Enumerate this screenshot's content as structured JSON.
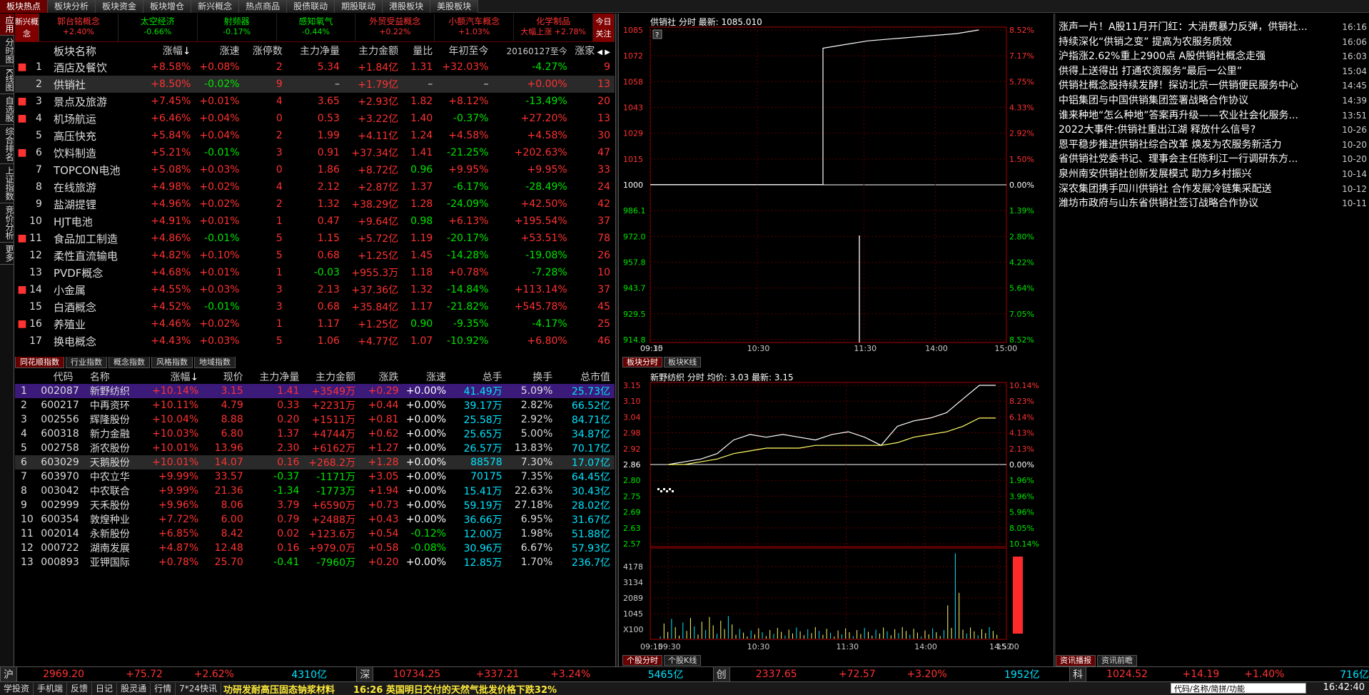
{
  "top_tabs": [
    "板块热点",
    "板块分析",
    "板块资金",
    "板块增仓",
    "新兴概念",
    "热点商品",
    "股债联动",
    "期股联动",
    "港股板块",
    "美股板块"
  ],
  "left_nav": [
    "应用",
    "分时图",
    "K线图",
    "自选股",
    "综合排名",
    "上证指数",
    "竞价分析",
    "更多"
  ],
  "concept_bar": {
    "left_label": "新兴概念",
    "right_label": "今日关注",
    "items": [
      {
        "name": "郭台铭概念",
        "pct": "+2.40%",
        "color": "#ff3232"
      },
      {
        "name": "太空经济",
        "pct": "-0.66%",
        "color": "#00e600"
      },
      {
        "name": "射频器",
        "pct": "-0.17%",
        "color": "#00e600"
      },
      {
        "name": "感知氧气",
        "pct": "-0.44%",
        "color": "#00e600"
      },
      {
        "name": "外贸受益概念",
        "pct": "+0.22%",
        "color": "#ff3232"
      },
      {
        "name": "小额汽车概念",
        "pct": "+1.03%",
        "color": "#ff3232"
      },
      {
        "name": "化学制品",
        "pct": "大幅上涨 +2.78%",
        "color": "#ff3232"
      }
    ]
  },
  "sector_table": {
    "headers": [
      "板块名称",
      "涨幅",
      "涨速",
      "涨停数",
      "主力净量",
      "主力金额",
      "量比",
      "年初至今",
      "20160127至今",
      "涨家"
    ],
    "rows": [
      {
        "idx": "1",
        "mark": "■",
        "name": "酒店及餐饮",
        "chg": "+8.58%",
        "spd": "+0.08%",
        "lim": "2",
        "net": "5.34",
        "amt": "+1.84亿",
        "vr": "1.31",
        "ytd": "+32.03%",
        "since": "-4.27%",
        "up": "9"
      },
      {
        "idx": "2",
        "mark": "",
        "name": "供销社",
        "chg": "+8.50%",
        "spd": "-0.02%",
        "lim": "9",
        "net": "–",
        "amt": "+1.79亿",
        "vr": "–",
        "ytd": "–",
        "since": "+0.00%",
        "up": "13"
      },
      {
        "idx": "3",
        "mark": "■",
        "name": "景点及旅游",
        "chg": "+7.45%",
        "spd": "+0.01%",
        "lim": "4",
        "net": "3.65",
        "amt": "+2.93亿",
        "vr": "1.82",
        "ytd": "+8.12%",
        "since": "-13.49%",
        "up": "20"
      },
      {
        "idx": "4",
        "mark": "■",
        "name": "机场航运",
        "chg": "+6.46%",
        "spd": "+0.04%",
        "lim": "0",
        "net": "0.53",
        "amt": "+3.22亿",
        "vr": "1.40",
        "ytd": "-0.37%",
        "since": "+27.20%",
        "up": "13"
      },
      {
        "idx": "5",
        "mark": "",
        "name": "高压快充",
        "chg": "+5.84%",
        "spd": "+0.04%",
        "lim": "2",
        "net": "1.99",
        "amt": "+4.11亿",
        "vr": "1.24",
        "ytd": "+4.58%",
        "since": "+4.58%",
        "up": "30"
      },
      {
        "idx": "6",
        "mark": "■",
        "name": "饮料制造",
        "chg": "+5.21%",
        "spd": "-0.01%",
        "lim": "3",
        "net": "0.91",
        "amt": "+37.34亿",
        "vr": "1.41",
        "ytd": "-21.25%",
        "since": "+202.63%",
        "up": "47"
      },
      {
        "idx": "7",
        "mark": "",
        "name": "TOPCON电池",
        "chg": "+5.08%",
        "spd": "+0.03%",
        "lim": "0",
        "net": "1.86",
        "amt": "+8.72亿",
        "vr": "0.96",
        "ytd": "+9.95%",
        "since": "+9.95%",
        "up": "33"
      },
      {
        "idx": "8",
        "mark": "",
        "name": "在线旅游",
        "chg": "+4.98%",
        "spd": "+0.02%",
        "lim": "4",
        "net": "2.12",
        "amt": "+2.87亿",
        "vr": "1.37",
        "ytd": "-6.17%",
        "since": "-28.49%",
        "up": "24"
      },
      {
        "idx": "9",
        "mark": "",
        "name": "盐湖提锂",
        "chg": "+4.96%",
        "spd": "+0.02%",
        "lim": "2",
        "net": "1.32",
        "amt": "+38.29亿",
        "vr": "1.28",
        "ytd": "-24.09%",
        "since": "+42.50%",
        "up": "42"
      },
      {
        "idx": "10",
        "mark": "",
        "name": "HJT电池",
        "chg": "+4.91%",
        "spd": "+0.01%",
        "lim": "1",
        "net": "0.47",
        "amt": "+9.64亿",
        "vr": "0.98",
        "ytd": "+6.13%",
        "since": "+195.54%",
        "up": "37"
      },
      {
        "idx": "11",
        "mark": "■",
        "name": "食品加工制造",
        "chg": "+4.86%",
        "spd": "-0.01%",
        "lim": "5",
        "net": "1.15",
        "amt": "+5.72亿",
        "vr": "1.19",
        "ytd": "-20.17%",
        "since": "+53.51%",
        "up": "78"
      },
      {
        "idx": "12",
        "mark": "",
        "name": "柔性直流输电",
        "chg": "+4.82%",
        "spd": "+0.10%",
        "lim": "5",
        "net": "0.68",
        "amt": "+1.25亿",
        "vr": "1.45",
        "ytd": "-14.28%",
        "since": "-19.08%",
        "up": "26"
      },
      {
        "idx": "13",
        "mark": "",
        "name": "PVDF概念",
        "chg": "+4.68%",
        "spd": "+0.01%",
        "lim": "1",
        "net": "-0.03",
        "amt": "+955.3万",
        "vr": "1.18",
        "ytd": "+0.78%",
        "since": "-7.28%",
        "up": "10"
      },
      {
        "idx": "14",
        "mark": "■",
        "name": "小金属",
        "chg": "+4.55%",
        "spd": "+0.03%",
        "lim": "3",
        "net": "2.13",
        "amt": "+37.36亿",
        "vr": "1.32",
        "ytd": "-14.84%",
        "since": "+113.14%",
        "up": "37"
      },
      {
        "idx": "15",
        "mark": "",
        "name": "白酒概念",
        "chg": "+4.52%",
        "spd": "-0.01%",
        "lim": "3",
        "net": "0.68",
        "amt": "+35.84亿",
        "vr": "1.17",
        "ytd": "-21.82%",
        "since": "+545.78%",
        "up": "45"
      },
      {
        "idx": "16",
        "mark": "■",
        "name": "养殖业",
        "chg": "+4.46%",
        "spd": "+0.02%",
        "lim": "1",
        "net": "1.17",
        "amt": "+1.25亿",
        "vr": "0.90",
        "ytd": "-9.35%",
        "since": "-4.17%",
        "up": "25"
      },
      {
        "idx": "17",
        "mark": "",
        "name": "换电概念",
        "chg": "+4.43%",
        "spd": "+0.03%",
        "lim": "5",
        "net": "1.06",
        "amt": "+4.77亿",
        "vr": "1.07",
        "ytd": "-10.92%",
        "since": "+6.80%",
        "up": "46"
      }
    ]
  },
  "index_tabs": [
    "同花顺指数",
    "行业指数",
    "概念指数",
    "风格指数",
    "地域指数"
  ],
  "stock_table": {
    "headers": [
      "代码",
      "名称",
      "涨幅",
      "现价",
      "主力净量",
      "主力金额",
      "涨跌",
      "涨速",
      "总手",
      "换手",
      "总市值"
    ],
    "rows": [
      {
        "idx": "1",
        "code": "002087",
        "name": "新野纺织",
        "chg": "+10.14%",
        "price": "3.15",
        "net": "1.41",
        "amt": "+3549万",
        "diff": "+0.29",
        "spd": "+0.00%",
        "vol": "41.49万",
        "turn": "5.09%",
        "cap": "25.73亿"
      },
      {
        "idx": "2",
        "code": "600217",
        "name": "中再资环",
        "chg": "+10.11%",
        "price": "4.79",
        "net": "0.33",
        "amt": "+2231万",
        "diff": "+0.44",
        "spd": "+0.00%",
        "vol": "39.17万",
        "turn": "2.82%",
        "cap": "66.52亿"
      },
      {
        "idx": "3",
        "code": "002556",
        "name": "辉隆股份",
        "chg": "+10.04%",
        "price": "8.88",
        "net": "0.20",
        "amt": "+1511万",
        "diff": "+0.81",
        "spd": "+0.00%",
        "vol": "25.58万",
        "turn": "2.92%",
        "cap": "84.71亿"
      },
      {
        "idx": "4",
        "code": "600318",
        "name": "新力金融",
        "chg": "+10.03%",
        "price": "6.80",
        "net": "1.37",
        "amt": "+4744万",
        "diff": "+0.62",
        "spd": "+0.00%",
        "vol": "25.65万",
        "turn": "5.00%",
        "cap": "34.87亿"
      },
      {
        "idx": "5",
        "code": "002758",
        "name": "浙农股份",
        "chg": "+10.01%",
        "price": "13.96",
        "net": "2.30",
        "amt": "+6162万",
        "diff": "+1.27",
        "spd": "+0.00%",
        "vol": "26.57万",
        "turn": "13.83%",
        "cap": "70.17亿"
      },
      {
        "idx": "6",
        "code": "603029",
        "name": "天鹅股份",
        "chg": "+10.01%",
        "price": "14.07",
        "net": "0.16",
        "amt": "+268.2万",
        "diff": "+1.28",
        "spd": "+0.00%",
        "vol": "88578",
        "turn": "7.30%",
        "cap": "17.07亿"
      },
      {
        "idx": "7",
        "code": "603970",
        "name": "中农立华",
        "chg": "+9.99%",
        "price": "33.57",
        "net": "-0.37",
        "amt": "-1171万",
        "diff": "+3.05",
        "spd": "+0.00%",
        "vol": "70175",
        "turn": "7.35%",
        "cap": "64.45亿"
      },
      {
        "idx": "8",
        "code": "003042",
        "name": "中农联合",
        "chg": "+9.99%",
        "price": "21.36",
        "net": "-1.34",
        "amt": "-1773万",
        "diff": "+1.94",
        "spd": "+0.00%",
        "vol": "15.41万",
        "turn": "22.63%",
        "cap": "30.43亿"
      },
      {
        "idx": "9",
        "code": "002999",
        "name": "天禾股份",
        "chg": "+9.96%",
        "price": "8.06",
        "net": "3.79",
        "amt": "+6590万",
        "diff": "+0.73",
        "spd": "+0.00%",
        "vol": "59.19万",
        "turn": "27.18%",
        "cap": "28.02亿"
      },
      {
        "idx": "10",
        "code": "600354",
        "name": "敦煌种业",
        "chg": "+7.72%",
        "price": "6.00",
        "net": "0.79",
        "amt": "+2488万",
        "diff": "+0.43",
        "spd": "+0.00%",
        "vol": "36.66万",
        "turn": "6.95%",
        "cap": "31.67亿"
      },
      {
        "idx": "11",
        "code": "002014",
        "name": "永新股份",
        "chg": "+6.85%",
        "price": "8.42",
        "net": "0.02",
        "amt": "+123.6万",
        "diff": "+0.54",
        "spd": "-0.12%",
        "vol": "12.00万",
        "turn": "1.98%",
        "cap": "51.88亿"
      },
      {
        "idx": "12",
        "code": "000722",
        "name": "湖南发展",
        "chg": "+4.87%",
        "price": "12.48",
        "net": "0.16",
        "amt": "+979.0万",
        "diff": "+0.58",
        "spd": "-0.08%",
        "vol": "30.96万",
        "turn": "6.67%",
        "cap": "57.93亿"
      },
      {
        "idx": "13",
        "code": "000893",
        "name": "亚钾国际",
        "chg": "+0.78%",
        "price": "25.70",
        "net": "-0.41",
        "amt": "-7960万",
        "diff": "+0.20",
        "spd": "+0.00%",
        "vol": "12.85万",
        "turn": "1.70%",
        "cap": "236.7亿"
      }
    ]
  },
  "chart_data": [
    {
      "type": "line",
      "title": "供销社 分时 最新: 1085.010",
      "x_ticks": [
        "09:15",
        "09:30",
        "10:30",
        "11:30",
        "14:00",
        "15:00"
      ],
      "y_left_ticks": [
        "1085",
        "1072",
        "1058",
        "1043",
        "1029",
        "1015",
        "1000",
        "986.1",
        "972.0",
        "957.8",
        "943.7",
        "929.5",
        "914.8"
      ],
      "y_right_ticks": [
        "8.52%",
        "7.17%",
        "5.75%",
        "4.33%",
        "2.92%",
        "1.50%",
        "0.00%",
        "1.39%",
        "2.80%",
        "4.22%",
        "5.64%",
        "7.05%",
        "8.52%"
      ],
      "base": 1000,
      "ylim": [
        914.8,
        1085
      ],
      "series": [
        {
          "values": [
            1000,
            1000,
            1000,
            1000,
            1075,
            1077,
            1079,
            1080,
            1081,
            1082,
            1083,
            1085
          ]
        }
      ],
      "tabs": [
        "板块分时",
        "板块K线"
      ]
    },
    {
      "type": "line",
      "title": "新野纺织 分时 均价: 3.03 最新: 3.15",
      "x_ticks": [
        "09:15",
        "09:30",
        "10:30",
        "11:30",
        "14:00",
        "14:57",
        "15:00"
      ],
      "y_left_ticks": [
        "3.15",
        "3.10",
        "3.04",
        "2.98",
        "2.92",
        "2.86",
        "2.80",
        "2.75",
        "2.69",
        "2.63",
        "2.57"
      ],
      "y_right_ticks": [
        "10.14%",
        "8.23%",
        "6.14%",
        "4.13%",
        "2.13%",
        "0.00%",
        "1.96%",
        "3.96%",
        "5.96%",
        "8.05%",
        "10.14%"
      ],
      "vol_ticks": [
        "4178",
        "3134",
        "2089",
        "1045",
        "X100"
      ],
      "base": 2.86,
      "ylim": [
        2.57,
        3.15
      ],
      "series": [
        {
          "values": [
            2.86,
            2.87,
            2.88,
            2.9,
            2.95,
            2.97,
            2.96,
            2.97,
            2.96,
            2.95,
            2.97,
            2.98,
            2.96,
            2.93,
            3.0,
            3.02,
            3.03,
            3.05,
            3.1,
            3.15,
            3.15
          ]
        },
        {
          "values": [
            2.86,
            2.86,
            2.87,
            2.88,
            2.9,
            2.91,
            2.92,
            2.92,
            2.92,
            2.93,
            2.93,
            2.93,
            2.93,
            2.93,
            2.94,
            2.96,
            2.97,
            2.98,
            3.0,
            3.03,
            3.03
          ]
        }
      ],
      "tabs": [
        "个股分时",
        "个股K线"
      ]
    }
  ],
  "news": [
    {
      "title": "涨声一片！A股11月开门红：大消费暴力反弹，供销社...",
      "time": "16:16"
    },
    {
      "title": "持续深化“供销之变” 提高为农服务质效",
      "time": "16:06"
    },
    {
      "title": "沪指涨2.62%重上2900点 A股供销社概念走强",
      "time": "16:03"
    },
    {
      "title": "供得上送得出 打通农资服务“最后一公里”",
      "time": "15:04"
    },
    {
      "title": "供销社概念股持续发酵！探访北京一供销便民服务中心",
      "time": "14:45"
    },
    {
      "title": "中铝集团与中国供销集团签署战略合作协议",
      "time": "14:39"
    },
    {
      "title": "谁来种地“怎么种地”答案再升级——农业社会化服务...",
      "time": "13:51"
    },
    {
      "title": "2022大事件:供销社重出江湖 释放什么信号?",
      "time": "10-26"
    },
    {
      "title": "恩平稳步推进供销社综合改革 焕发为农服务新活力",
      "time": "10-20"
    },
    {
      "title": "省供销社党委书记、理事会主任陈利江一行调研东方...",
      "time": "10-20"
    },
    {
      "title": "泉州南安供销社创新发展模式 助力乡村振兴",
      "time": "10-14"
    },
    {
      "title": "深农集团携手四川供销社 合作发展冷链集采配送",
      "time": "10-12"
    },
    {
      "title": "潍坊市政府与山东省供销社签订战略合作协议",
      "time": "10-11"
    }
  ],
  "news_tabs": [
    "资讯播报",
    "资讯前瞻"
  ],
  "status_bar": [
    {
      "label": "沪",
      "value": "2969.20",
      "chg": "+75.72",
      "pct": "+2.62%",
      "amt": "4310亿"
    },
    {
      "label": "深",
      "value": "10734.25",
      "chg": "+337.21",
      "pct": "+3.24%",
      "amt": "5465亿"
    },
    {
      "label": "创",
      "value": "2337.65",
      "chg": "+72.57",
      "pct": "+3.20%",
      "amt": "1952亿"
    },
    {
      "label": "科",
      "value": "1024.52",
      "chg": "+14.19",
      "pct": "+1.40%",
      "amt": "716亿"
    }
  ],
  "bottom_bar": {
    "items": [
      "学投资",
      "手机端",
      "反馈",
      "日记",
      "股灵通",
      "行情",
      "7*24快讯"
    ],
    "ticker": "功研发耐高压固态钠浆材料　　16:26 英国明日交付的天然气批发价格下跌32%",
    "search_placeholder": "代码/名称/简拼/功能",
    "clock": "16:42:40"
  }
}
